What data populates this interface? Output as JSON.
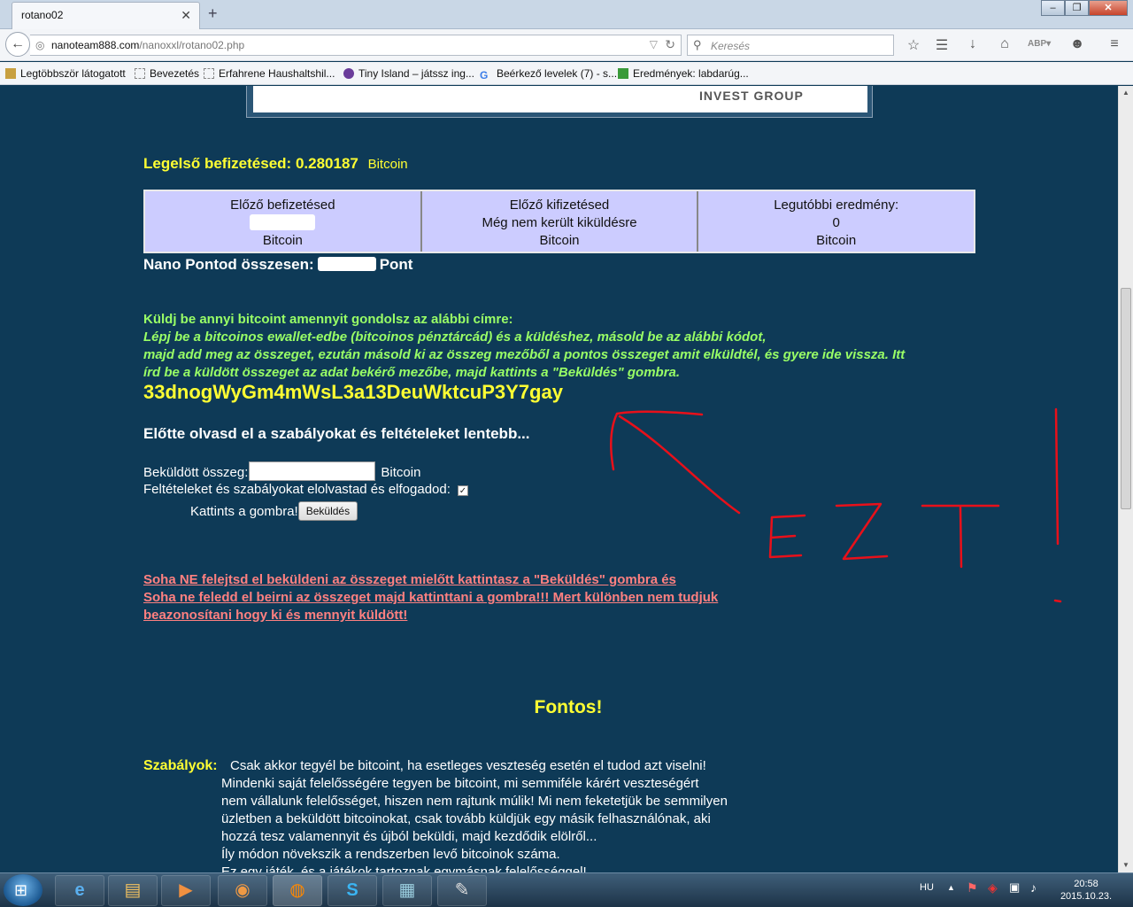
{
  "browser": {
    "tab_title": "rotano02",
    "tab_close": "✕",
    "new_tab": "+",
    "url_host": "nanoteam888.com",
    "url_path": "/nanoxxl/rotano02.php",
    "search_placeholder": "Keresés"
  },
  "bookmarks": [
    "Legtöbbször látogatott",
    "Bevezetés",
    "Erfahrene Haushaltshil...",
    "Tiny Island – játssz ing...",
    "Beérkező levelek (7) - s...",
    "Eredmények: labdarúg..."
  ],
  "banner": {
    "text": "INVEST GROUP"
  },
  "first_deposit": {
    "label": "Legelső befizetésed:",
    "value": "0.280187",
    "unit": "Bitcoin"
  },
  "stats": [
    {
      "title": "Előző befizetésed",
      "value": "",
      "unit": "Bitcoin",
      "redacted": true
    },
    {
      "title": "Előző kifizetésed",
      "value": "Még nem került kiküldésre",
      "unit": "Bitcoin",
      "redacted": false
    },
    {
      "title": "Legutóbbi eredmény:",
      "value": "0",
      "unit": "Bitcoin",
      "redacted": false
    }
  ],
  "points": {
    "label": "Nano Pontod összesen:",
    "unit": "Pont"
  },
  "instructions": {
    "heading": "Küldj be annyi bitcoint amennyit gondolsz az alábbi címre:",
    "line1": "Lépj be a bitcoinos ewallet-edbe (bitcoinos pénztárcád) és a küldéshez, másold be az alábbi kódot,",
    "line2": "majd add meg az összeget, ezután másold ki az összeg mezőből a pontos összeget amit elküldtél, és gyere ide vissza. Itt",
    "line3": "írd be a küldött összeget az adat bekérő mezőbe, majd kattints a \"Beküldés\" gombra."
  },
  "address": "33dnogWyGm4mWsL3a13DeuWktcuP3Y7gay",
  "read_first": "Előtte olvasd el a szabályokat és feltételeket lentebb...",
  "form": {
    "amount_label": "Beküldött összeg:",
    "amount_value": "",
    "amount_unit": "Bitcoin",
    "terms_label": "Feltételeket és szabályokat elolvastad és elfogadod:",
    "terms_checked": "✓",
    "click_label": "Kattints a gombra!",
    "submit_label": "Beküldés"
  },
  "warning": {
    "line1": "Soha NE felejtsd el beküldeni az összeget mielőtt kattintasz a \"Beküldés\" gombra és",
    "line2": "Soha ne feledd el beirni az összeget majd kattinttani a gombra!!! Mert különben nem tudjuk",
    "line3": "beazonosítani hogy ki és mennyit küldött! "
  },
  "fontos": "Fontos!",
  "rules": {
    "label": "Szabályok:",
    "lines": [
      "Csak akkor tegyél be bitcoint, ha esetleges veszteség esetén el tudod azt viselni!",
      "Mindenki saját felelősségére tegyen be bitcoint, mi semmiféle kárért veszteségért",
      "nem vállalunk felelősséget, hiszen nem rajtunk múlik! Mi nem feketetjük be semmilyen",
      "üzletben a beküldött bitcoinokat, csak tovább küldjük egy másik felhasználónak, aki",
      "hozzá tesz valamennyit és újból beküldi, majd kezdődik elölről...",
      "Íly módon növekszik a rendszerben levő bitcoinok száma.",
      "Ez egy játék, és a játékok tartoznak egymásnak felelősséggel!"
    ]
  },
  "annotation": {
    "text": "EZT!",
    "color": "#e8101a"
  },
  "taskbar": {
    "language": "HU",
    "time": "20:58",
    "date": "2015.10.23."
  },
  "colors": {
    "page_bg": "#0e3a57",
    "yellow": "#ffff33",
    "green": "#99ff66",
    "warning": "#ff8080",
    "stats_bg": "#ccccff"
  }
}
